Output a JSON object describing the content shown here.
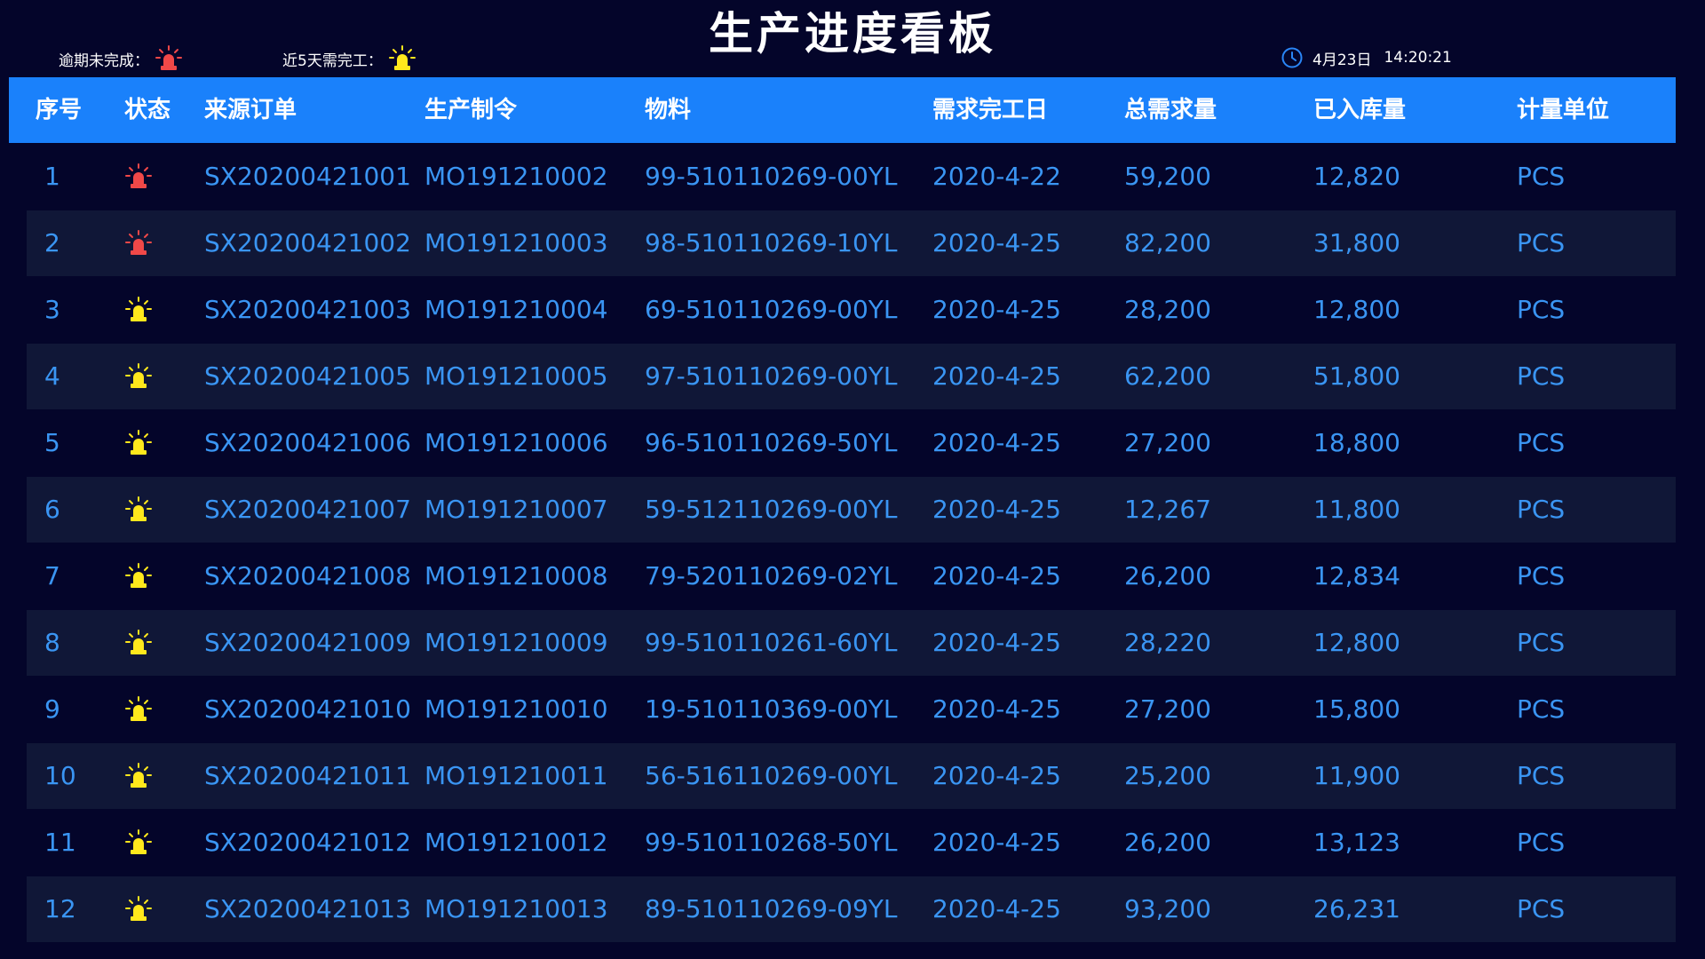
{
  "header": {
    "title": "生产进度看板",
    "legend_overdue_label": "逾期未完成：",
    "legend_due_label": "近5天需完工：",
    "date": "4月23日",
    "time": "14:20:21"
  },
  "colors": {
    "overdue": "#f04848",
    "due": "#ffe81c",
    "accent": "#1a81fb",
    "text": "#3a95f3"
  },
  "icons": {
    "overdue": "alarm-light-red-icon",
    "due": "alarm-light-yellow-icon",
    "clock": "clock-icon"
  },
  "table": {
    "columns": [
      "序号",
      "状态",
      "来源订单",
      "生产制令",
      "物料",
      "需求完工日",
      "总需求量",
      "已入库量",
      "计量单位"
    ],
    "rows": [
      {
        "no": "1",
        "status": "overdue",
        "order": "SX20200421001",
        "mo": "MO191210002",
        "material": "99-510110269-00YL",
        "due": "2020-4-22",
        "total": "59,200",
        "stocked": "12,820",
        "unit": "PCS"
      },
      {
        "no": "2",
        "status": "overdue",
        "order": "SX20200421002",
        "mo": "MO191210003",
        "material": "98-510110269-10YL",
        "due": "2020-4-25",
        "total": "82,200",
        "stocked": "31,800",
        "unit": "PCS"
      },
      {
        "no": "3",
        "status": "due",
        "order": "SX20200421003",
        "mo": "MO191210004",
        "material": "69-510110269-00YL",
        "due": "2020-4-25",
        "total": "28,200",
        "stocked": "12,800",
        "unit": "PCS"
      },
      {
        "no": "4",
        "status": "due",
        "order": "SX20200421005",
        "mo": "MO191210005",
        "material": "97-510110269-00YL",
        "due": "2020-4-25",
        "total": "62,200",
        "stocked": "51,800",
        "unit": "PCS"
      },
      {
        "no": "5",
        "status": "due",
        "order": "SX20200421006",
        "mo": "MO191210006",
        "material": "96-510110269-50YL",
        "due": "2020-4-25",
        "total": "27,200",
        "stocked": "18,800",
        "unit": "PCS"
      },
      {
        "no": "6",
        "status": "due",
        "order": "SX20200421007",
        "mo": "MO191210007",
        "material": "59-512110269-00YL",
        "due": "2020-4-25",
        "total": "12,267",
        "stocked": "11,800",
        "unit": "PCS"
      },
      {
        "no": "7",
        "status": "due",
        "order": "SX20200421008",
        "mo": "MO191210008",
        "material": "79-520110269-02YL",
        "due": "2020-4-25",
        "total": "26,200",
        "stocked": "12,834",
        "unit": "PCS"
      },
      {
        "no": "8",
        "status": "due",
        "order": "SX20200421009",
        "mo": "MO191210009",
        "material": "99-510110261-60YL",
        "due": "2020-4-25",
        "total": "28,220",
        "stocked": "12,800",
        "unit": "PCS"
      },
      {
        "no": "9",
        "status": "due",
        "order": "SX20200421010",
        "mo": "MO191210010",
        "material": "19-510110369-00YL",
        "due": "2020-4-25",
        "total": "27,200",
        "stocked": "15,800",
        "unit": "PCS"
      },
      {
        "no": "10",
        "status": "due",
        "order": "SX20200421011",
        "mo": "MO191210011",
        "material": "56-516110269-00YL",
        "due": "2020-4-25",
        "total": "25,200",
        "stocked": "11,900",
        "unit": "PCS"
      },
      {
        "no": "11",
        "status": "due",
        "order": "SX20200421012",
        "mo": "MO191210012",
        "material": "99-510110268-50YL",
        "due": "2020-4-25",
        "total": "26,200",
        "stocked": "13,123",
        "unit": "PCS"
      },
      {
        "no": "12",
        "status": "due",
        "order": "SX20200421013",
        "mo": "MO191210013",
        "material": "89-510110269-09YL",
        "due": "2020-4-25",
        "total": "93,200",
        "stocked": "26,231",
        "unit": "PCS"
      }
    ]
  }
}
